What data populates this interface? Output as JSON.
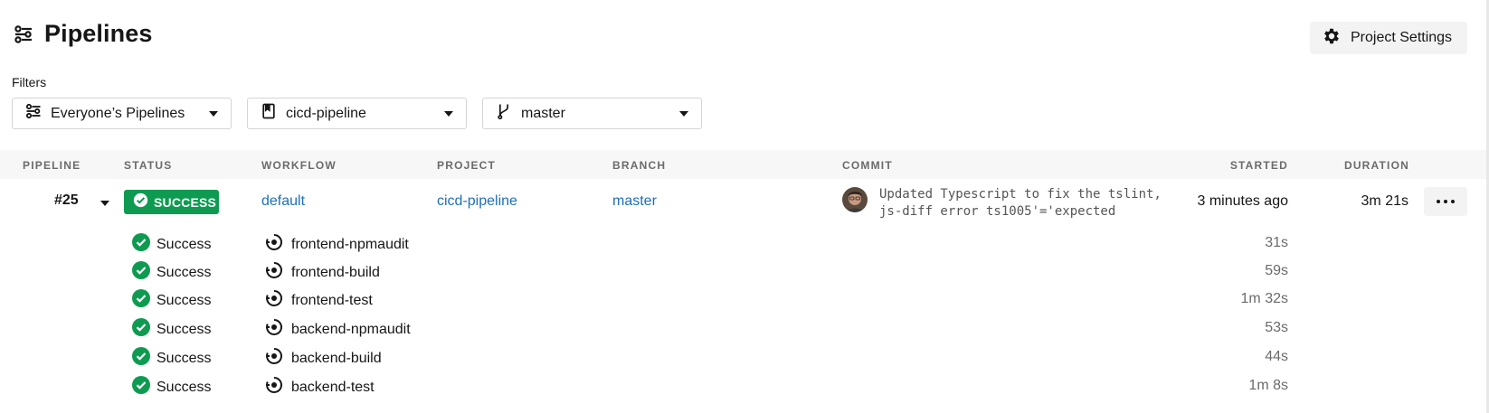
{
  "header": {
    "title": "Pipelines",
    "title_icon": "pipelines-icon",
    "settings_label": "Project Settings",
    "settings_icon": "gear-icon"
  },
  "filters": {
    "label": "Filters",
    "items": [
      {
        "value": "Everyone’s Pipelines",
        "icon": "pipelines-icon"
      },
      {
        "value": "cicd-pipeline",
        "icon": "bookmark-icon"
      },
      {
        "value": "master",
        "icon": "branch-icon"
      }
    ]
  },
  "table": {
    "columns": [
      "PIPELINE",
      "STATUS",
      "WORKFLOW",
      "PROJECT",
      "BRANCH",
      "COMMIT",
      "STARTED",
      "DURATION"
    ],
    "pipeline": {
      "number": "#25",
      "status": "SUCCESS",
      "workflow": "default",
      "project": "cicd-pipeline",
      "branch": "master",
      "commit_line1": "Updated Typescript to fix the tslint,",
      "commit_line2": "js-diff error ts1005'='expected",
      "started": "3 minutes ago",
      "duration": "3m 21s"
    },
    "jobs": [
      {
        "status": "Success",
        "name": "frontend-npmaudit",
        "duration": "31s"
      },
      {
        "status": "Success",
        "name": "frontend-build",
        "duration": "59s"
      },
      {
        "status": "Success",
        "name": "frontend-test",
        "duration": "1m 32s"
      },
      {
        "status": "Success",
        "name": "backend-npmaudit",
        "duration": "53s"
      },
      {
        "status": "Success",
        "name": "backend-build",
        "duration": "44s"
      },
      {
        "status": "Success",
        "name": "backend-test",
        "duration": "1m 8s"
      }
    ]
  },
  "colors": {
    "success": "#0e9b51",
    "link": "#1f6fb8",
    "header_bg": "#f7f7f7"
  }
}
